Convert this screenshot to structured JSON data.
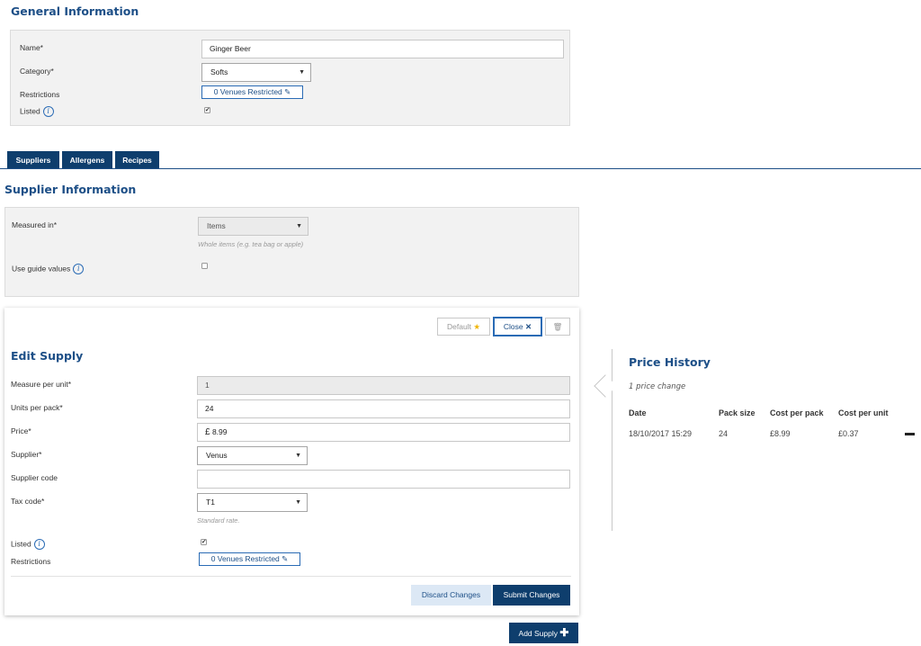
{
  "general": {
    "title": "General Information",
    "name_label": "Name*",
    "name_value": "Ginger Beer",
    "category_label": "Category*",
    "category_value": "Softs",
    "restrictions_label": "Restrictions",
    "restrictions_button": "0 Venues Restricted",
    "listed_label": "Listed",
    "listed_checked": true
  },
  "tabs": [
    {
      "label": "Suppliers",
      "active": true
    },
    {
      "label": "Allergens",
      "active": false
    },
    {
      "label": "Recipes",
      "active": false
    }
  ],
  "supplier_info": {
    "title": "Supplier Information",
    "measured_label": "Measured in*",
    "measured_value": "Items",
    "measured_hint": "Whole items (e.g. tea bag or apple)",
    "guide_label": "Use guide values",
    "guide_checked": false
  },
  "edit_supply": {
    "default_button": "Default",
    "close_button": "Close",
    "title": "Edit Supply",
    "measure_label": "Measure per unit*",
    "measure_value": "1",
    "units_label": "Units per pack*",
    "units_value": "24",
    "price_label": "Price*",
    "price_currency": "£",
    "price_value": "8.99",
    "supplier_label": "Supplier*",
    "supplier_value": "Venus",
    "code_label": "Supplier code",
    "code_value": "",
    "tax_label": "Tax code*",
    "tax_value": "T1",
    "tax_hint": "Standard rate.",
    "listed_label": "Listed",
    "listed_checked": true,
    "restrictions_label": "Restrictions",
    "restrictions_button": "0 Venues Restricted",
    "discard_button": "Discard Changes",
    "submit_button": "Submit Changes"
  },
  "add_supply_button": "Add Supply",
  "price_history": {
    "title": "Price History",
    "subtitle": "1 price change",
    "columns": [
      "Date",
      "Pack size",
      "Cost per pack",
      "Cost per unit"
    ],
    "rows": [
      {
        "date": "18/10/2017 15:29",
        "pack_size": "24",
        "cost_per_pack": "£8.99",
        "cost_per_unit": "£0.37"
      }
    ]
  },
  "colors": {
    "brand": "#1d4f87",
    "tab_bg": "#0e3e6d",
    "panel_bg": "#f2f2f2"
  }
}
